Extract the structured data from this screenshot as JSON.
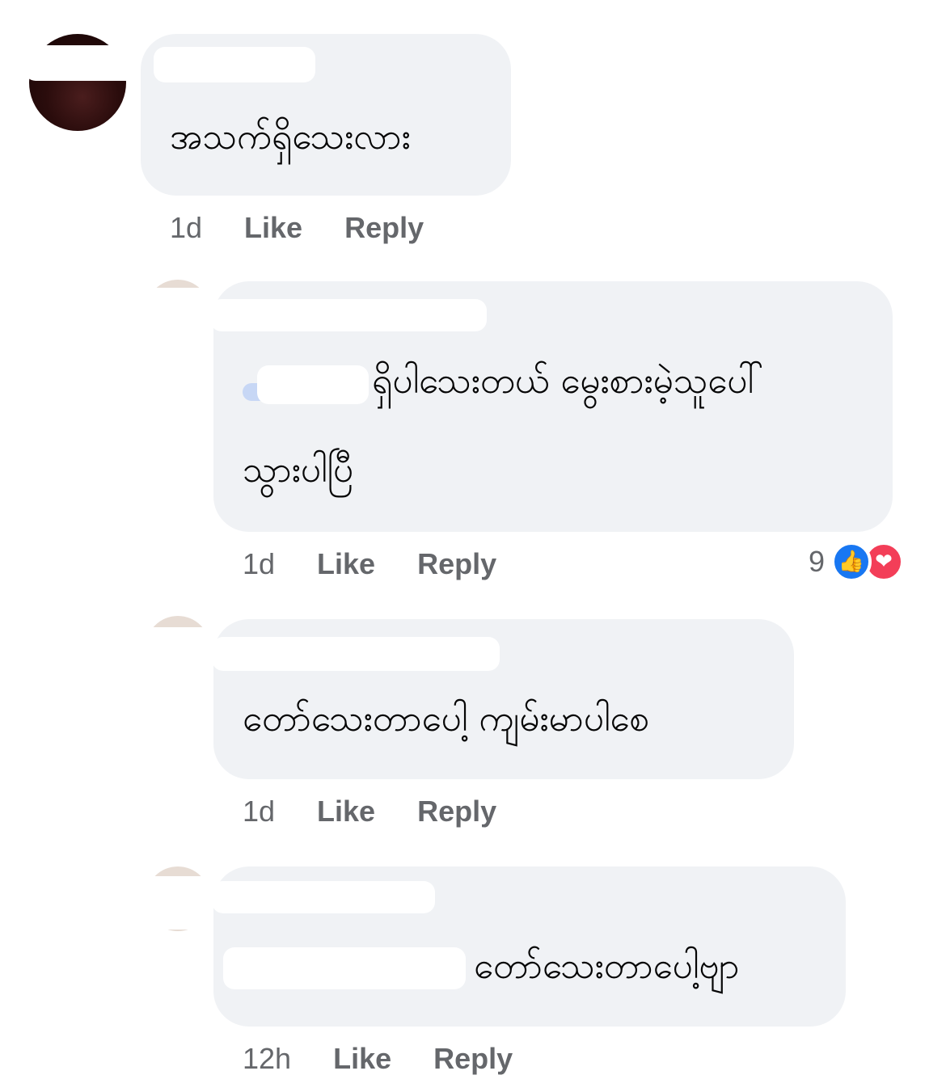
{
  "comments": [
    {
      "text": "အသက်ရှိသေးလား",
      "time": "1d",
      "like": "Like",
      "reply": "Reply"
    },
    {
      "text_line1": "ရှိပါသေးတယ် မွေးစားမဲ့သူပေါ်",
      "text_line2": "သွားပါပြီ",
      "time": "1d",
      "like": "Like",
      "reply": "Reply",
      "reactions": {
        "count": "9",
        "icons": [
          "like-icon",
          "love-icon"
        ]
      }
    },
    {
      "text": "တော်သေးတာပေါ့ ကျမ်းမာပါစေ",
      "time": "1d",
      "like": "Like",
      "reply": "Reply"
    },
    {
      "text": "တော်သေးတာပေါ့ဗျာ",
      "time": "12h",
      "like": "Like",
      "reply": "Reply"
    }
  ],
  "colors": {
    "bubble": "#f0f2f5",
    "meta": "#65676b",
    "like_blue": "#1877f2",
    "love_red": "#f33e58"
  }
}
